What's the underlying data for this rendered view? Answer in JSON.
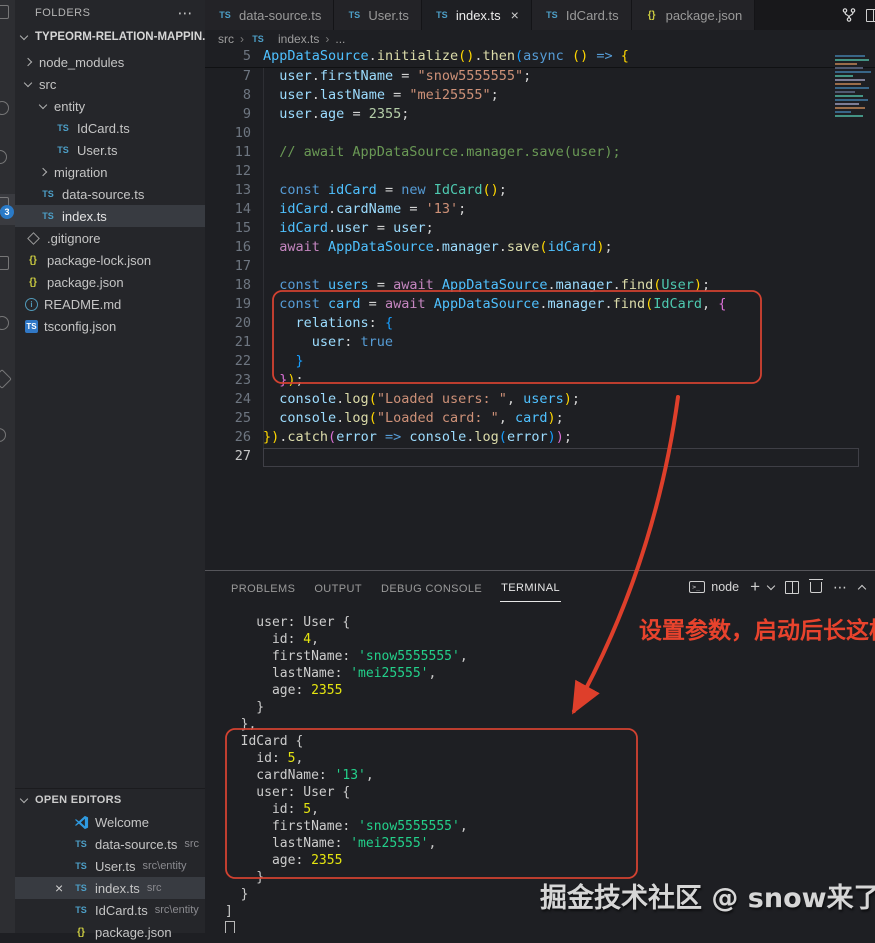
{
  "window": {
    "sidebar_header": "FOLDERS",
    "project_section": "TYPEORM-RELATION-MAPPIN...",
    "open_editors_title": "OPEN EDITORS"
  },
  "ui": {
    "close": "×",
    "sep": "›",
    "more": "⋯"
  },
  "activity_bar": {
    "badge_count": "3"
  },
  "explorer_tree": [
    {
      "label": "node_modules",
      "indent": 1,
      "kind": "folder",
      "state": "collapsed"
    },
    {
      "label": "src",
      "indent": 1,
      "kind": "folder",
      "state": "expanded"
    },
    {
      "label": "entity",
      "indent": 2,
      "kind": "folder",
      "state": "expanded"
    },
    {
      "label": "IdCard.ts",
      "indent": 3,
      "kind": "ts"
    },
    {
      "label": "User.ts",
      "indent": 3,
      "kind": "ts"
    },
    {
      "label": "migration",
      "indent": 2,
      "kind": "folder",
      "state": "collapsed"
    },
    {
      "label": "data-source.ts",
      "indent": 2,
      "kind": "ts"
    },
    {
      "label": "index.ts",
      "indent": 2,
      "kind": "ts",
      "selected": true
    },
    {
      "label": ".gitignore",
      "indent": 1,
      "kind": "git"
    },
    {
      "label": "package-lock.json",
      "indent": 1,
      "kind": "json"
    },
    {
      "label": "package.json",
      "indent": 1,
      "kind": "json"
    },
    {
      "label": "README.md",
      "indent": 1,
      "kind": "info"
    },
    {
      "label": "tsconfig.json",
      "indent": 1,
      "kind": "tsblue"
    }
  ],
  "open_editors": [
    {
      "label": "Welcome",
      "path": "",
      "kind": "vscode"
    },
    {
      "label": "data-source.ts",
      "path": "src",
      "kind": "ts"
    },
    {
      "label": "User.ts",
      "path": "src\\entity",
      "kind": "ts"
    },
    {
      "label": "index.ts",
      "path": "src",
      "kind": "ts",
      "active": true
    },
    {
      "label": "IdCard.ts",
      "path": "src\\entity",
      "kind": "ts"
    },
    {
      "label": "package.json",
      "path": "",
      "kind": "json"
    }
  ],
  "editor_tabs": [
    {
      "label": "data-source.ts",
      "kind": "ts"
    },
    {
      "label": "User.ts",
      "kind": "ts"
    },
    {
      "label": "index.ts",
      "kind": "ts",
      "active": true
    },
    {
      "label": "IdCard.ts",
      "kind": "ts"
    },
    {
      "label": "package.json",
      "kind": "json"
    }
  ],
  "breadcrumb": {
    "items": [
      {
        "label": "src"
      },
      {
        "label": "index.ts",
        "icon": "ts"
      },
      {
        "label": "..."
      }
    ]
  },
  "code": {
    "lines": [
      {
        "n": "5",
        "sticky": true,
        "t": [
          [
            "AppDataSource",
            "b2"
          ],
          [
            ".",
            "pu"
          ],
          [
            "initialize",
            "fn"
          ],
          [
            "()",
            "py"
          ],
          [
            ".",
            "pu"
          ],
          [
            "then",
            "fn"
          ],
          [
            "(",
            "pb"
          ],
          [
            "async",
            "kw"
          ],
          [
            " ",
            "pu"
          ],
          [
            "()",
            "py"
          ],
          [
            " ",
            "pu"
          ],
          [
            "=>",
            "kw"
          ],
          [
            " ",
            "pu"
          ],
          [
            "{",
            "py"
          ]
        ]
      },
      {
        "n": "7",
        "t": [
          [
            "  user",
            "b1"
          ],
          [
            ".",
            "pu"
          ],
          [
            "firstName",
            "b1"
          ],
          [
            " = ",
            "pu"
          ],
          [
            "\"snow5555555\"",
            "st"
          ],
          [
            ";",
            "pu"
          ]
        ]
      },
      {
        "n": "8",
        "t": [
          [
            "  user",
            "b1"
          ],
          [
            ".",
            "pu"
          ],
          [
            "lastName",
            "b1"
          ],
          [
            " = ",
            "pu"
          ],
          [
            "\"mei25555\"",
            "st"
          ],
          [
            ";",
            "pu"
          ]
        ]
      },
      {
        "n": "9",
        "t": [
          [
            "  user",
            "b1"
          ],
          [
            ".",
            "pu"
          ],
          [
            "age",
            "b1"
          ],
          [
            " = ",
            "pu"
          ],
          [
            "2355",
            "nu"
          ],
          [
            ";",
            "pu"
          ]
        ]
      },
      {
        "n": "10",
        "t": []
      },
      {
        "n": "11",
        "t": [
          [
            "  // await AppDataSource.manager.save(user);",
            "cm"
          ]
        ]
      },
      {
        "n": "12",
        "t": []
      },
      {
        "n": "13",
        "t": [
          [
            "  ",
            "pu"
          ],
          [
            "const",
            "kw"
          ],
          [
            " idCard",
            "b2"
          ],
          [
            " = ",
            "pu"
          ],
          [
            "new",
            "kw"
          ],
          [
            " ",
            "pu"
          ],
          [
            "IdCard",
            "cl"
          ],
          [
            "()",
            "py"
          ],
          [
            ";",
            "pu"
          ]
        ]
      },
      {
        "n": "14",
        "t": [
          [
            "  idCard",
            "b2"
          ],
          [
            ".",
            "pu"
          ],
          [
            "cardName",
            "b1"
          ],
          [
            " = ",
            "pu"
          ],
          [
            "'13'",
            "st"
          ],
          [
            ";",
            "pu"
          ]
        ]
      },
      {
        "n": "15",
        "t": [
          [
            "  idCard",
            "b2"
          ],
          [
            ".",
            "pu"
          ],
          [
            "user",
            "b1"
          ],
          [
            " = ",
            "pu"
          ],
          [
            "user",
            "b1"
          ],
          [
            ";",
            "pu"
          ]
        ]
      },
      {
        "n": "16",
        "t": [
          [
            "  ",
            "pu"
          ],
          [
            "await",
            "aw"
          ],
          [
            " ",
            "pu"
          ],
          [
            "AppDataSource",
            "b2"
          ],
          [
            ".",
            "pu"
          ],
          [
            "manager",
            "b1"
          ],
          [
            ".",
            "pu"
          ],
          [
            "save",
            "fn"
          ],
          [
            "(",
            "py"
          ],
          [
            "idCard",
            "b2"
          ],
          [
            ")",
            "py"
          ],
          [
            ";",
            "pu"
          ]
        ]
      },
      {
        "n": "17",
        "t": []
      },
      {
        "n": "18",
        "t": [
          [
            "  ",
            "pu"
          ],
          [
            "const",
            "kw"
          ],
          [
            " users",
            "b2"
          ],
          [
            " = ",
            "pu"
          ],
          [
            "await",
            "aw"
          ],
          [
            " ",
            "pu"
          ],
          [
            "AppDataSource",
            "b2"
          ],
          [
            ".",
            "pu"
          ],
          [
            "manager",
            "b1"
          ],
          [
            ".",
            "pu"
          ],
          [
            "find",
            "fn"
          ],
          [
            "(",
            "py"
          ],
          [
            "User",
            "cl"
          ],
          [
            ")",
            "py"
          ],
          [
            ";",
            "pu"
          ]
        ]
      },
      {
        "n": "19",
        "t": [
          [
            "  ",
            "pu"
          ],
          [
            "const",
            "kw"
          ],
          [
            " card",
            "b2"
          ],
          [
            " = ",
            "pu"
          ],
          [
            "await",
            "aw"
          ],
          [
            " ",
            "pu"
          ],
          [
            "AppDataSource",
            "b2"
          ],
          [
            ".",
            "pu"
          ],
          [
            "manager",
            "b1"
          ],
          [
            ".",
            "pu"
          ],
          [
            "find",
            "fn"
          ],
          [
            "(",
            "py"
          ],
          [
            "IdCard",
            "cl"
          ],
          [
            ", ",
            "pu"
          ],
          [
            "{",
            "pp"
          ]
        ]
      },
      {
        "n": "20",
        "t": [
          [
            "    relations",
            "b1"
          ],
          [
            ": ",
            "pu"
          ],
          [
            "{",
            "pb"
          ]
        ]
      },
      {
        "n": "21",
        "t": [
          [
            "      user",
            "b1"
          ],
          [
            ": ",
            "pu"
          ],
          [
            "true",
            "kw"
          ]
        ]
      },
      {
        "n": "22",
        "t": [
          [
            "    }",
            "pb"
          ]
        ]
      },
      {
        "n": "23",
        "t": [
          [
            "  }",
            "pp"
          ],
          [
            ")",
            "py"
          ],
          [
            ";",
            "pu"
          ]
        ]
      },
      {
        "n": "24",
        "t": [
          [
            "  console",
            "b1"
          ],
          [
            ".",
            "pu"
          ],
          [
            "log",
            "fn"
          ],
          [
            "(",
            "py"
          ],
          [
            "\"Loaded users: \"",
            "st"
          ],
          [
            ", ",
            "pu"
          ],
          [
            "users",
            "b2"
          ],
          [
            ")",
            "py"
          ],
          [
            ";",
            "pu"
          ]
        ]
      },
      {
        "n": "25",
        "t": [
          [
            "  console",
            "b1"
          ],
          [
            ".",
            "pu"
          ],
          [
            "log",
            "fn"
          ],
          [
            "(",
            "py"
          ],
          [
            "\"Loaded card: \"",
            "st"
          ],
          [
            ", ",
            "pu"
          ],
          [
            "card",
            "b2"
          ],
          [
            ")",
            "py"
          ],
          [
            ";",
            "pu"
          ]
        ]
      },
      {
        "n": "26",
        "t": [
          [
            "})",
            "py"
          ],
          [
            ".",
            "pu"
          ],
          [
            "catch",
            "fn"
          ],
          [
            "(",
            "pp"
          ],
          [
            "error",
            "b1"
          ],
          [
            " ",
            "pu"
          ],
          [
            "=>",
            "kw"
          ],
          [
            " console",
            "b1"
          ],
          [
            ".",
            "pu"
          ],
          [
            "log",
            "fn"
          ],
          [
            "(",
            "pb"
          ],
          [
            "error",
            "b1"
          ],
          [
            ")",
            "pb"
          ],
          [
            ")",
            "pp"
          ],
          [
            ";",
            "pu"
          ]
        ]
      },
      {
        "n": "27",
        "cur": true,
        "t": []
      }
    ]
  },
  "panel": {
    "tabs": [
      {
        "label": "PROBLEMS"
      },
      {
        "label": "OUTPUT"
      },
      {
        "label": "DEBUG CONSOLE"
      },
      {
        "label": "TERMINAL",
        "active": true
      }
    ],
    "shell": "node",
    "terminal": {
      "lines": [
        [
          [
            "    user: User {",
            "tw"
          ]
        ],
        [
          [
            "      id: ",
            "tw"
          ],
          [
            "4",
            "ty"
          ],
          [
            ",",
            "tw"
          ]
        ],
        [
          [
            "      firstName: ",
            "tw"
          ],
          [
            "'snow5555555'",
            "tg"
          ],
          [
            ",",
            "tw"
          ]
        ],
        [
          [
            "      lastName: ",
            "tw"
          ],
          [
            "'mei25555'",
            "tg"
          ],
          [
            ",",
            "tw"
          ]
        ],
        [
          [
            "      age: ",
            "tw"
          ],
          [
            "2355",
            "ty"
          ]
        ],
        [
          [
            "    }",
            "tw"
          ]
        ],
        [
          [
            "  },",
            "tw"
          ]
        ],
        [
          [
            "  IdCard {",
            "tw"
          ]
        ],
        [
          [
            "    id: ",
            "tw"
          ],
          [
            "5",
            "ty"
          ],
          [
            ",",
            "tw"
          ]
        ],
        [
          [
            "    cardName: ",
            "tw"
          ],
          [
            "'13'",
            "tg"
          ],
          [
            ",",
            "tw"
          ]
        ],
        [
          [
            "    user: User {",
            "tw"
          ]
        ],
        [
          [
            "      id: ",
            "tw"
          ],
          [
            "5",
            "ty"
          ],
          [
            ",",
            "tw"
          ]
        ],
        [
          [
            "      firstName: ",
            "tw"
          ],
          [
            "'snow5555555'",
            "tg"
          ],
          [
            ",",
            "tw"
          ]
        ],
        [
          [
            "      lastName: ",
            "tw"
          ],
          [
            "'mei25555'",
            "tg"
          ],
          [
            ",",
            "tw"
          ]
        ],
        [
          [
            "      age: ",
            "tw"
          ],
          [
            "2355",
            "ty"
          ]
        ],
        [
          [
            "    }",
            "tw"
          ]
        ],
        [
          [
            "  }",
            "tw"
          ]
        ],
        [
          [
            "]",
            "tw"
          ]
        ]
      ]
    }
  },
  "annotations": {
    "note": "设置参数，启动后长这样",
    "watermark": "掘金技术社区 @ snow来了",
    "accent_color": "#de3f2b"
  }
}
